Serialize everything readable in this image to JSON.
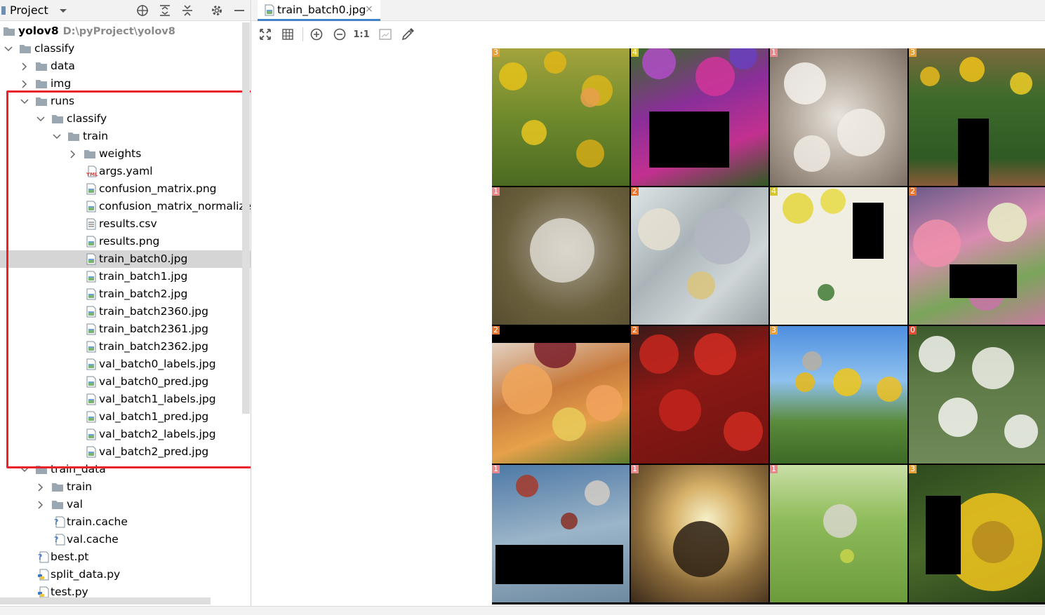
{
  "panel": {
    "title": "Project",
    "header_icons": [
      "locate-icon",
      "expand-all-icon",
      "collapse-all-icon",
      "gear-icon",
      "minimize-icon"
    ]
  },
  "tree": [
    {
      "label": "yolov8",
      "path": "D:\\pyProject\\yolov8",
      "type": "folder",
      "expanded": true
    },
    {
      "label": "classify",
      "type": "folder",
      "expanded": true
    },
    {
      "label": "data",
      "type": "folder",
      "expanded": false
    },
    {
      "label": "img",
      "type": "folder",
      "expanded": false
    },
    {
      "label": "runs",
      "type": "folder",
      "expanded": true
    },
    {
      "label": "classify",
      "type": "folder",
      "expanded": true
    },
    {
      "label": "train",
      "type": "folder",
      "expanded": true
    },
    {
      "label": "weights",
      "type": "folder",
      "expanded": false
    },
    {
      "label": "args.yaml",
      "type": "yaml"
    },
    {
      "label": "confusion_matrix.png",
      "type": "image"
    },
    {
      "label": "confusion_matrix_normalized.p",
      "type": "image"
    },
    {
      "label": "results.csv",
      "type": "text"
    },
    {
      "label": "results.png",
      "type": "image"
    },
    {
      "label": "train_batch0.jpg",
      "type": "image",
      "selected": true
    },
    {
      "label": "train_batch1.jpg",
      "type": "image"
    },
    {
      "label": "train_batch2.jpg",
      "type": "image"
    },
    {
      "label": "train_batch2360.jpg",
      "type": "image"
    },
    {
      "label": "train_batch2361.jpg",
      "type": "image"
    },
    {
      "label": "train_batch2362.jpg",
      "type": "image"
    },
    {
      "label": "val_batch0_labels.jpg",
      "type": "image"
    },
    {
      "label": "val_batch0_pred.jpg",
      "type": "image"
    },
    {
      "label": "val_batch1_labels.jpg",
      "type": "image"
    },
    {
      "label": "val_batch1_pred.jpg",
      "type": "image"
    },
    {
      "label": "val_batch2_labels.jpg",
      "type": "image"
    },
    {
      "label": "val_batch2_pred.jpg",
      "type": "image"
    },
    {
      "label": "train_data",
      "type": "folder",
      "expanded": true
    },
    {
      "label": "train",
      "type": "folder",
      "expanded": false
    },
    {
      "label": "val",
      "type": "folder",
      "expanded": false
    },
    {
      "label": "train.cache",
      "type": "unknown"
    },
    {
      "label": "val.cache",
      "type": "unknown"
    },
    {
      "label": "best.pt",
      "type": "unknown"
    },
    {
      "label": "split_data.py",
      "type": "python"
    },
    {
      "label": "test.py",
      "type": "python"
    }
  ],
  "editor": {
    "tab_label": "train_batch0.jpg",
    "tab_close": "×",
    "toolbar": {
      "actual_size_label": "1:1",
      "buttons": [
        "fit-screen-icon",
        "grid-icon",
        "zoom-in-icon",
        "zoom-out-icon",
        "actual-size-icon",
        "background-icon",
        "color-picker-icon"
      ]
    }
  },
  "image_grid": {
    "columns": 4,
    "rows": 4,
    "tiles": [
      {
        "label": "3",
        "label_color": "#e8a135",
        "scene": "sunfield"
      },
      {
        "label": "4",
        "label_color": "#d7c32a",
        "scene": "tulips"
      },
      {
        "label": "1",
        "label_color": "#e9878a",
        "scene": "dandelion-macro"
      },
      {
        "label": "3",
        "label_color": "#e8a135",
        "scene": "sunflower-pots"
      },
      {
        "label": "1",
        "label_color": "#e9878a",
        "scene": "dandelion-brown"
      },
      {
        "label": "2",
        "label_color": "#e8752d",
        "scene": "pale-rose"
      },
      {
        "label": "4",
        "label_color": "#d7c32a",
        "scene": "tulip-drawing"
      },
      {
        "label": "2",
        "label_color": "#e8752d",
        "scene": "bouquet-pink"
      },
      {
        "label": "2",
        "label_color": "#e8752d",
        "scene": "rose-bouquet"
      },
      {
        "label": "2",
        "label_color": "#e8752d",
        "scene": "red-roses"
      },
      {
        "label": "3",
        "label_color": "#e8a135",
        "scene": "sunflower-sky"
      },
      {
        "label": "0",
        "label_color": "#e84d33",
        "scene": "daisies"
      },
      {
        "label": "1",
        "label_color": "#e9878a",
        "scene": "dandelion-seeds"
      },
      {
        "label": "1",
        "label_color": "#e9878a",
        "scene": "dandelion-sunset"
      },
      {
        "label": "1",
        "label_color": "#e9878a",
        "scene": "dandelion-green"
      },
      {
        "label": "3",
        "label_color": "#e8a135",
        "scene": "sunflower-close"
      }
    ]
  }
}
